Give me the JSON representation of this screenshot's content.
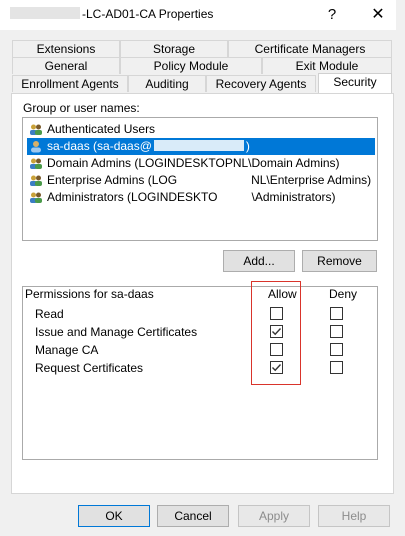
{
  "window": {
    "title": "-LC-AD01-CA Properties",
    "help_glyph": "?",
    "close_glyph": "✕"
  },
  "tabs": {
    "row1": [
      "Extensions",
      "Storage",
      "Certificate Managers"
    ],
    "row2": [
      "General",
      "Policy Module",
      "Exit Module"
    ],
    "row3": [
      "Enrollment Agents",
      "Auditing",
      "Recovery Agents",
      "Security"
    ],
    "active": "Security"
  },
  "security": {
    "group_label": "Group or user names:",
    "users": [
      {
        "name": "Authenticated Users",
        "selected": false
      },
      {
        "name": "sa-daas (sa-daas@",
        "suffix": ")",
        "selected": true
      },
      {
        "name": "Domain Admins (LOGINDESKTOPNL\\Domain Admins)",
        "selected": false
      },
      {
        "name": "Enterprise Admins (LOG",
        "suffix": "NL\\Enterprise Admins)",
        "selected": false
      },
      {
        "name": "Administrators (LOGINDESKTO",
        "suffix": "\\Administrators)",
        "selected": false
      }
    ],
    "add_button": "Add...",
    "remove_button": "Remove",
    "permissions_label": "Permissions for sa-daas",
    "allow_header": "Allow",
    "deny_header": "Deny",
    "permissions": [
      {
        "name": "Read",
        "allow": false,
        "deny": false
      },
      {
        "name": "Issue and Manage Certificates",
        "allow": true,
        "deny": false
      },
      {
        "name": "Manage CA",
        "allow": false,
        "deny": false
      },
      {
        "name": "Request Certificates",
        "allow": true,
        "deny": false
      }
    ]
  },
  "footer": {
    "ok": "OK",
    "cancel": "Cancel",
    "apply": "Apply",
    "help": "Help"
  },
  "colors": {
    "selection": "#0078d7",
    "highlight_box": "#d9342b"
  }
}
